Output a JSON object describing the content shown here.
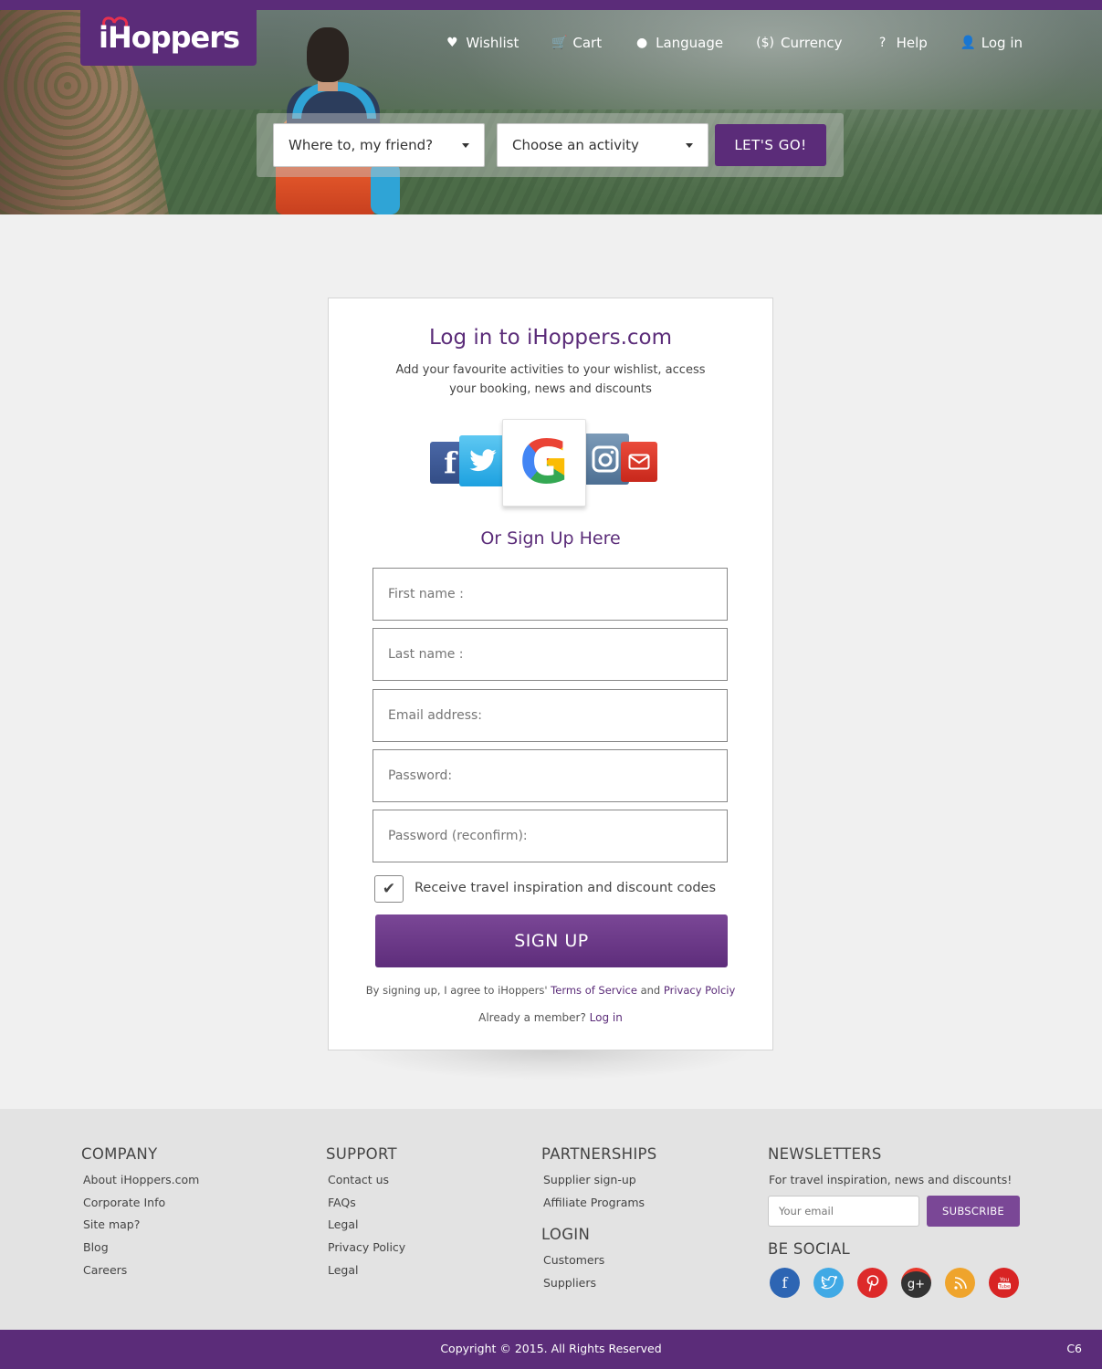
{
  "brand": {
    "logo_text": "iHoppers"
  },
  "nav": [
    {
      "label": "Wishlist",
      "icon": "♥"
    },
    {
      "label": "Cart",
      "icon": "🛒"
    },
    {
      "label": "Language",
      "icon": "●"
    },
    {
      "label": "Currency",
      "icon": "($)"
    },
    {
      "label": "Help",
      "icon": "?"
    },
    {
      "label": "Log in",
      "icon": "👤"
    }
  ],
  "search": {
    "destination_value": "Where to, my friend?",
    "activity_value": "Choose an activity",
    "go_label": "LET'S GO!"
  },
  "login_card": {
    "title": "Log in to iHoppers.com",
    "subtitle": "Add your favourite activities to your wishlist, access your booking, news and discounts",
    "or_signup": "Or Sign Up Here",
    "fields": {
      "first_name": "First name :",
      "last_name": "Last name :",
      "email": "Email address:",
      "password": "Password:",
      "password_confirm": "Password (reconfirm):"
    },
    "checkbox_label": "Receive travel inspiration and discount codes",
    "signup_label": "SIGN UP",
    "terms_prefix": "By signing up, I agree to iHoppers'",
    "terms_link": "Terms of Service",
    "terms_and": "and",
    "privacy_link": "Privacy Polciy",
    "member_text": "Already a member?",
    "member_link": "Log in"
  },
  "footer": {
    "company": {
      "title": "COMPANY",
      "links": [
        "About iHoppers.com",
        "Corporate Info",
        "Site map?",
        "Blog",
        "Careers"
      ]
    },
    "support": {
      "title": "SUPPORT",
      "links": [
        "Contact us",
        "FAQs",
        "Legal",
        "Privacy Policy",
        "Legal"
      ]
    },
    "partnerships": {
      "title": "PARTNERSHIPS",
      "links": [
        "Supplier sign-up",
        "Affiliate Programs"
      ]
    },
    "login": {
      "title": "LOGIN",
      "links": [
        "Customers",
        "Suppliers"
      ]
    },
    "newsletters": {
      "title": "NEWSLETTERS",
      "text": "For travel inspiration, news and discounts!",
      "email_placeholder": "Your email",
      "subscribe_label": "SUBSCRIBE"
    },
    "be_social": "BE SOCIAL"
  },
  "copyright": {
    "text": "Copyright © 2015. All Rights Reserved",
    "code": "C6"
  },
  "colors": {
    "brand_purple": "#5b2c79",
    "button_purple": "#7a4796"
  }
}
